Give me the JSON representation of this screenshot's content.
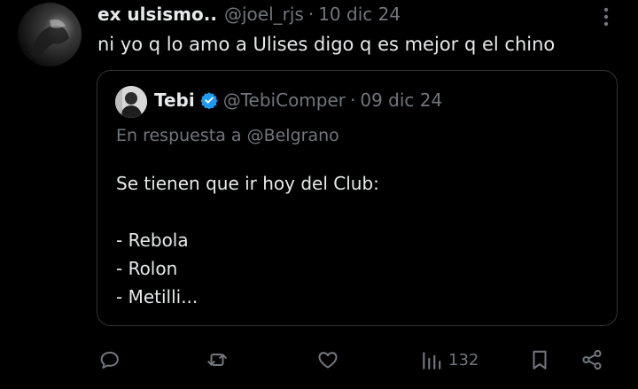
{
  "post": {
    "display_name": "ex ulsismo..",
    "handle": "@joel_rjs",
    "separator": "·",
    "date": "10 dic 24",
    "text": "ni yo q lo amo a Ulises digo q es mejor q el chino"
  },
  "quoted": {
    "display_name": "Tebi",
    "handle": "@TebiComper",
    "separator": "·",
    "date": "09 dic 24",
    "reply_to": "En respuesta a @Belgrano",
    "lines": [
      "Se tienen que ir hoy del Club:",
      "",
      "- Rebola",
      "- Rolon",
      "- Metilli..."
    ]
  },
  "actions": {
    "views": "132",
    "icons": [
      "reply-icon",
      "repost-icon",
      "like-icon",
      "views-icon",
      "bookmark-icon",
      "share-icon"
    ]
  },
  "colors": {
    "background": "#000000",
    "text": "#e7e9ea",
    "muted": "#71767b",
    "border": "#2f3336",
    "verified": "#1d9bf0"
  }
}
